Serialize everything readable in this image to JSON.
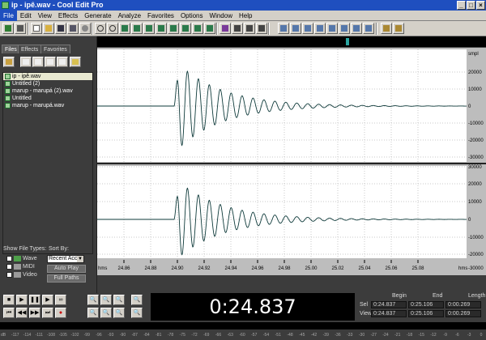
{
  "window": {
    "title": "ip - ipê.wav - Cool Edit Pro",
    "min": "_",
    "max": "□",
    "close": "×"
  },
  "menu": [
    "File",
    "Edit",
    "View",
    "Effects",
    "Generate",
    "Analyze",
    "Favorites",
    "Options",
    "Window",
    "Help"
  ],
  "panel": {
    "tabs": [
      "Files",
      "Effects",
      "Favorites"
    ],
    "files": [
      "ip - ipê.wav",
      "Untitled (2)",
      "marup - marupá (2).wav",
      "Untitled",
      "marup - marupá.wav"
    ],
    "show_file_types_label": "Show File Types:",
    "sort_by_label": "Sort By:",
    "types": [
      "Wave",
      "MIDI",
      "Video"
    ],
    "sort_value": "Recent Acc",
    "auto_play": "Auto Play",
    "full_paths": "Full Paths"
  },
  "wave": {
    "unit": "smpl",
    "ch1_ticks": [
      "20000",
      "10000",
      "0",
      "-10000",
      "-20000",
      "-30000"
    ],
    "ch2_ticks": [
      "30000",
      "20000",
      "10000",
      "0",
      "-10000",
      "-20000",
      "-30000"
    ],
    "time_unit_left": "hms",
    "time_unit_right": "hms",
    "time_ticks": [
      "24.86",
      "24.88",
      "24.90",
      "24.92",
      "24.94",
      "24.96",
      "24.98",
      "25.00",
      "25.02",
      "25.04",
      "25.06",
      "25.08"
    ],
    "colors": {
      "bg": "#ffffff",
      "wave": "#0e3a3a",
      "grid": "#c8c8c8"
    }
  },
  "time_display": "0:24.837",
  "selection": {
    "headers": [
      "Begin",
      "End",
      "Length"
    ],
    "sel_label": "Sel",
    "view_label": "View",
    "sel": [
      "0:24.837",
      "0:25.106",
      "0:00.269"
    ],
    "view": [
      "0:24.837",
      "0:25.106",
      "0:00.269"
    ]
  },
  "level_ticks": [
    "dB",
    "-117",
    "-114",
    "-111",
    "-108",
    "-105",
    "-102",
    "-99",
    "-96",
    "-93",
    "-90",
    "-87",
    "-84",
    "-81",
    "-78",
    "-75",
    "-72",
    "-69",
    "-66",
    "-63",
    "-60",
    "-57",
    "-54",
    "-51",
    "-48",
    "-45",
    "-42",
    "-39",
    "-36",
    "-33",
    "-30",
    "-27",
    "-24",
    "-21",
    "-18",
    "-15",
    "-12",
    "-9",
    "-6",
    "-3",
    "0"
  ]
}
